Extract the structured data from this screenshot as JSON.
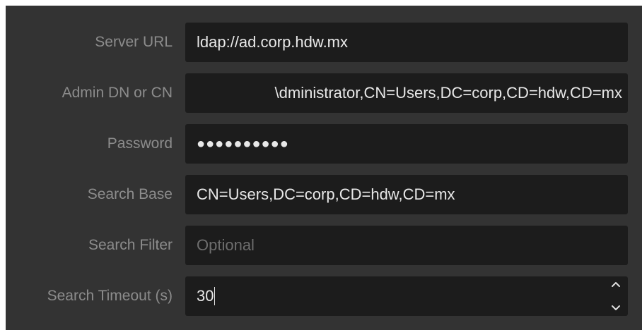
{
  "form": {
    "server_url": {
      "label": "Server URL",
      "value": "ldap://ad.corp.hdw.mx"
    },
    "admin_dn": {
      "label": "Admin DN or CN",
      "value": "\\dministrator,CN=Users,DC=corp,CD=hdw,CD=mx"
    },
    "password": {
      "label": "Password",
      "value": "●●●●●●●●●●"
    },
    "search_base": {
      "label": "Search Base",
      "value": "CN=Users,DC=corp,CD=hdw,CD=mx"
    },
    "search_filter": {
      "label": "Search Filter",
      "value": "",
      "placeholder": "Optional"
    },
    "search_timeout": {
      "label": "Search Timeout (s)",
      "value": "30"
    }
  },
  "colors": {
    "panel_bg": "#333333",
    "field_bg": "#1c1c1c",
    "label": "#8c8c8c",
    "text": "#e8e8e8",
    "placeholder": "#6e6e6e"
  },
  "icons": {
    "spinner_up": "chevron-up-icon",
    "spinner_down": "chevron-down-icon"
  }
}
